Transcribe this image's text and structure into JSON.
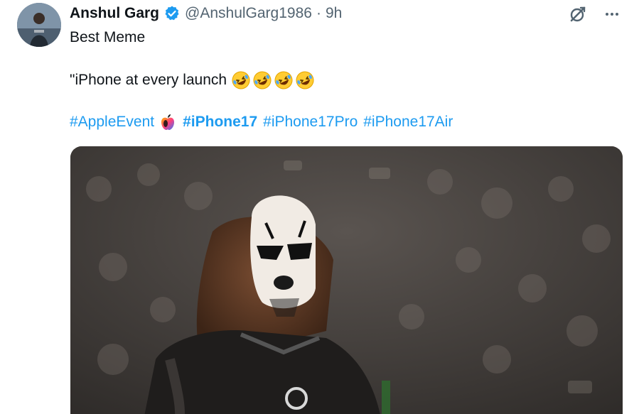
{
  "tweet": {
    "author": {
      "display_name": "Anshul Garg",
      "handle": "@AnshulGarg1986",
      "separator": "·",
      "time": "9h",
      "avatar_icon": "profile-photo",
      "verified_icon": "verified-badge-icon"
    },
    "actions": {
      "grok_icon": "grok-icon",
      "more_icon": "more-options-icon"
    },
    "text": {
      "line1": "Best Meme",
      "line2": "\"iPhone at every launch",
      "line2_emojis": [
        "rolling-laughing-emoji",
        "rolling-laughing-emoji",
        "rolling-laughing-emoji",
        "rolling-laughing-emoji"
      ]
    },
    "hashtags": [
      {
        "label": "#AppleEvent",
        "bold": false
      },
      {
        "label": "#iPhone17",
        "bold": true
      },
      {
        "label": "#iPhone17Pro",
        "bold": false
      },
      {
        "label": "#iPhone17Air",
        "bold": false
      }
    ],
    "media": {
      "type": "video-frame",
      "description_icon": "wrestler-face-paint-image"
    }
  },
  "colors": {
    "link": "#1d9bf0",
    "text": "#0f1419",
    "secondary": "#536471",
    "verified": "#1d9bf0"
  }
}
